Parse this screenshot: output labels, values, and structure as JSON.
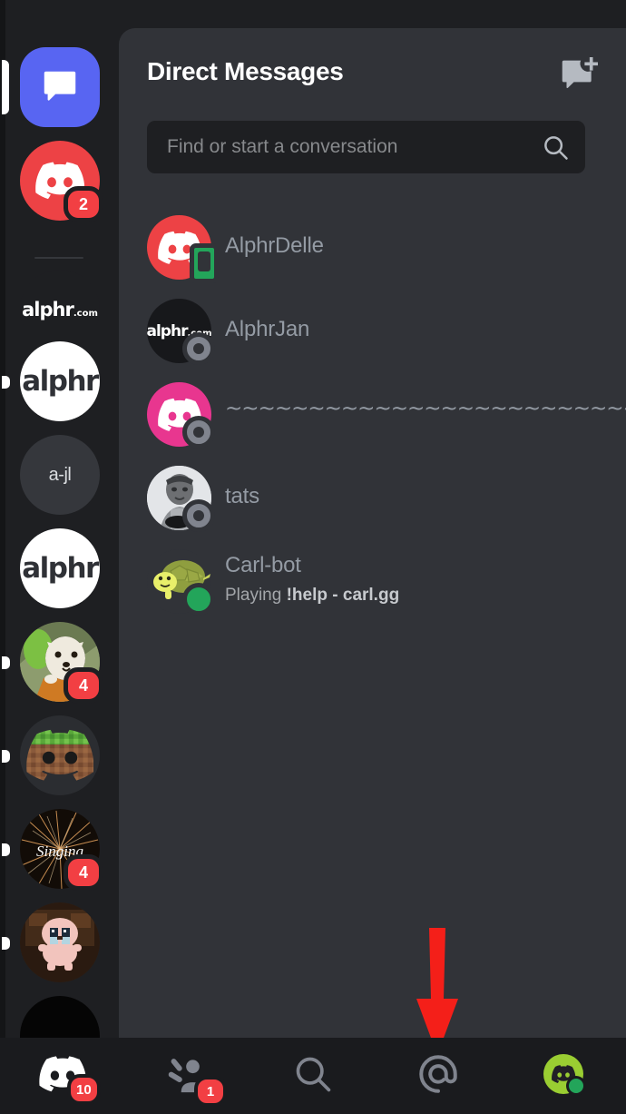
{
  "app": "Discord Mobile",
  "colors": {
    "rail_bg": "#1e1f22",
    "panel_bg": "#313338",
    "nav_bg": "#1a1b1e",
    "blurple": "#5865f2",
    "badge_red": "#f23f43",
    "online_green": "#23a55a",
    "offline_gray": "#80848e",
    "annotation_red": "#f41f19",
    "text_primary": "#ffffff",
    "text_muted": "#949ba4"
  },
  "server_rail": {
    "items": [
      {
        "name": "direct-messages",
        "label": "",
        "kind": "dm-home",
        "selected": true,
        "badge": "",
        "indicator": "selected"
      },
      {
        "name": "red-discord-server",
        "label": "",
        "kind": "discord-logo",
        "selected": false,
        "badge": "2",
        "indicator": "none"
      },
      {
        "name": "alphr-com-server",
        "label": "alphr",
        "sub": ".com",
        "kind": "wordmark-dark",
        "selected": false,
        "badge": "",
        "indicator": "none"
      },
      {
        "name": "alphr-white-server-1",
        "label": "alphr",
        "kind": "wordmark-white",
        "selected": false,
        "badge": "",
        "indicator": "dot"
      },
      {
        "name": "a-jl-server",
        "label": "a-jl",
        "kind": "text",
        "selected": false,
        "badge": "",
        "indicator": "none"
      },
      {
        "name": "alphr-white-server-2",
        "label": "alphr",
        "kind": "wordmark-white",
        "selected": false,
        "badge": "",
        "indicator": "none"
      },
      {
        "name": "shiba-server",
        "label": "",
        "kind": "photo-shiba",
        "selected": false,
        "badge": "4",
        "indicator": "dot"
      },
      {
        "name": "minecraft-server",
        "label": "",
        "kind": "minecraft-logo",
        "selected": false,
        "badge": "",
        "indicator": "dot"
      },
      {
        "name": "singing-server",
        "label": "Singing",
        "kind": "photo-fireworks",
        "selected": false,
        "badge": "4",
        "indicator": "dot"
      },
      {
        "name": "isaac-server",
        "label": "",
        "kind": "photo-isaac",
        "selected": false,
        "badge": "",
        "indicator": "dot"
      },
      {
        "name": "black-server",
        "label": "",
        "kind": "plain-dark",
        "selected": false,
        "badge": "",
        "indicator": "none"
      }
    ]
  },
  "header": {
    "title": "Direct Messages",
    "new_dm_icon": "new-message-icon"
  },
  "search": {
    "placeholder": "Find or start a conversation",
    "value": "",
    "icon": "search-icon"
  },
  "dm_list": [
    {
      "name": "AlphrDelle",
      "subtitle": "",
      "status": "mobile",
      "avatar": "red-discord-avatar"
    },
    {
      "name": "AlphrJan",
      "subtitle": "",
      "status": "offline",
      "avatar": "alphr-com-avatar"
    },
    {
      "name": "~~~~~~~~~~~~~~~~~~~~~~~~~~~~",
      "subtitle": "",
      "status": "offline",
      "avatar": "pink-discord-avatar"
    },
    {
      "name": "tats",
      "subtitle": "",
      "status": "offline",
      "avatar": "photo-avatar"
    },
    {
      "name": "Carl-bot",
      "subtitle_prefix": "Playing ",
      "subtitle_bold": "!help - carl.gg",
      "status": "online",
      "avatar": "turtle-avatar"
    }
  ],
  "bottom_nav": [
    {
      "name": "servers-tab",
      "icon": "discord-logo-icon",
      "badge": "10",
      "active": false
    },
    {
      "name": "friends-tab",
      "icon": "friends-wave-icon",
      "badge": "1",
      "active": false
    },
    {
      "name": "search-tab",
      "icon": "search-icon",
      "badge": "",
      "active": false
    },
    {
      "name": "mentions-tab",
      "icon": "at-mention-icon",
      "badge": "",
      "active": false
    },
    {
      "name": "profile-tab",
      "icon": "user-avatar-icon",
      "badge": "",
      "active": false
    }
  ],
  "annotation": {
    "type": "arrow-down",
    "points_to": "mentions-tab",
    "color": "#f41f19"
  }
}
